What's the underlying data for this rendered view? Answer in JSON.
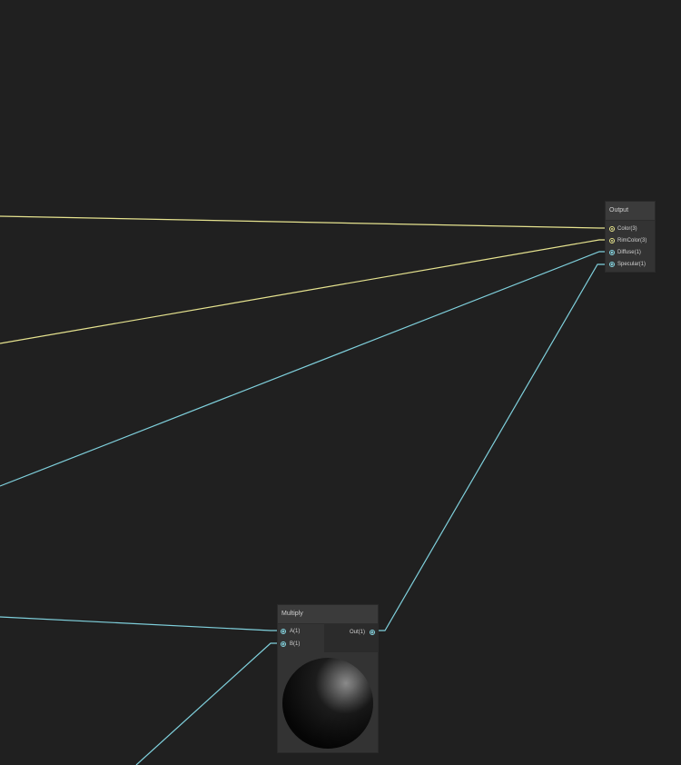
{
  "graph": {
    "background": "#202020",
    "port_colors": {
      "vector3": "#e8e58a",
      "vector1": "#84d4e0"
    },
    "wire_colors": {
      "vector3": "#e6e38f",
      "vector1": "#7fd0dc"
    }
  },
  "nodes": {
    "output": {
      "title": "Output",
      "inputs": [
        {
          "label": "Color(3)",
          "type": "vector3"
        },
        {
          "label": "RimColor(3)",
          "type": "vector3"
        },
        {
          "label": "Diffuse(1)",
          "type": "vector1"
        },
        {
          "label": "Specular(1)",
          "type": "vector1"
        }
      ]
    },
    "multiply": {
      "title": "Multiply",
      "inputs": [
        {
          "label": "A(1)",
          "type": "vector1"
        },
        {
          "label": "B(1)",
          "type": "vector1"
        }
      ],
      "outputs": [
        {
          "label": "Out(1)",
          "type": "vector1"
        }
      ],
      "preview": "sphere-preview"
    }
  }
}
